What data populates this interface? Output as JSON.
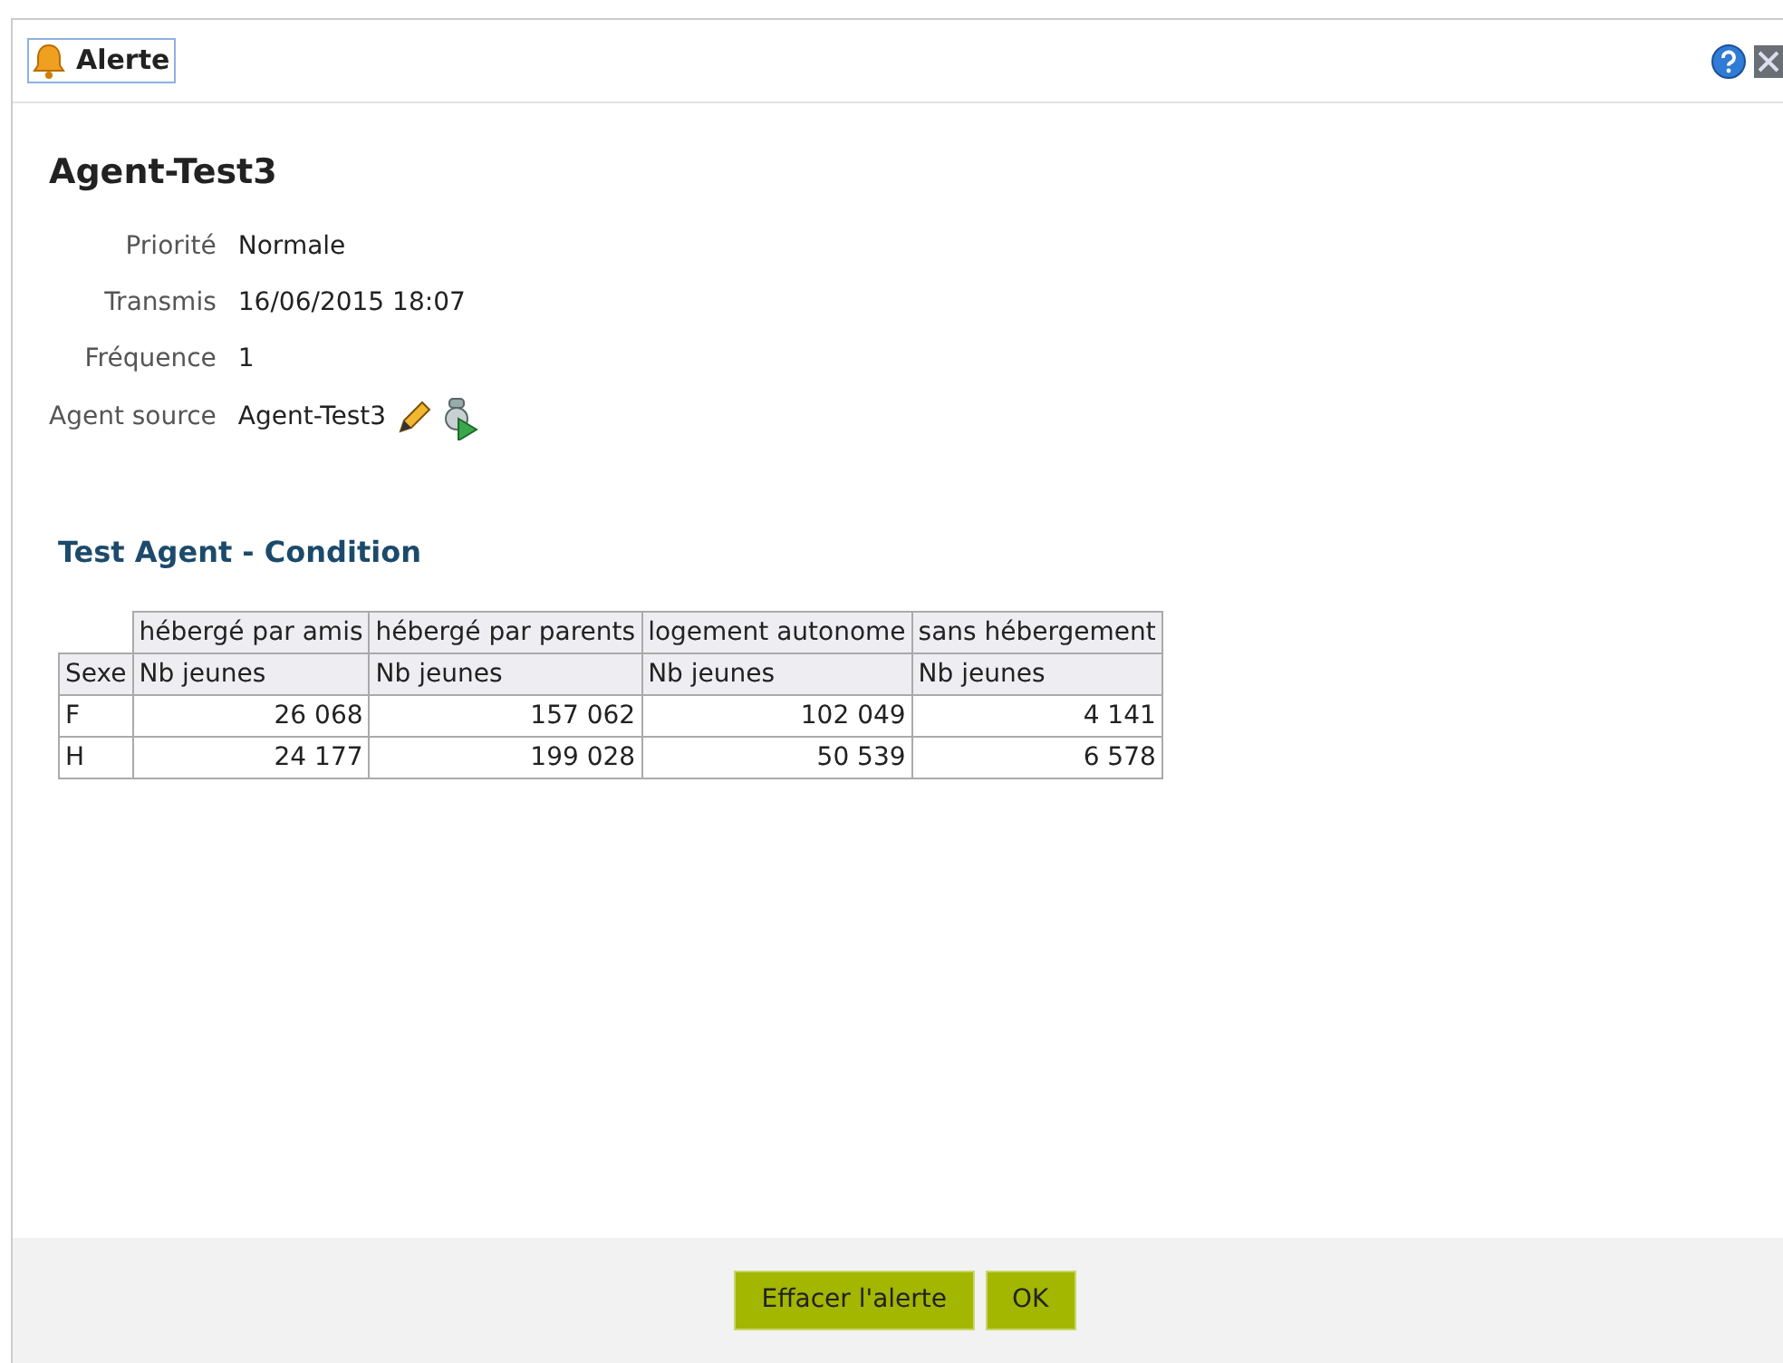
{
  "window": {
    "title": "Alerte"
  },
  "agent": {
    "name": "Agent-Test3"
  },
  "fields": [
    {
      "label": "Priorité",
      "value": "Normale"
    },
    {
      "label": "Transmis",
      "value": "16/06/2015 18:07"
    },
    {
      "label": "Fréquence",
      "value": "1"
    },
    {
      "label": "Agent source",
      "value": "Agent-Test3",
      "kind": "agent"
    }
  ],
  "section_title": "Test Agent - Condition",
  "table": {
    "columns": [
      "hébergé par amis",
      "hébergé par parents",
      "logement autonome",
      "sans hébergement"
    ],
    "row_header": "Sexe",
    "measures": [
      "Nb jeunes",
      "Nb jeunes",
      "Nb jeunes",
      "Nb jeunes"
    ],
    "rows": [
      {
        "label": "F",
        "values": [
          "26 068",
          "157 062",
          "102 049",
          "4 141"
        ]
      },
      {
        "label": "H",
        "values": [
          "24 177",
          "199 028",
          "50 539",
          "6 578"
        ]
      }
    ]
  },
  "buttons": [
    "Effacer l'alerte",
    "OK"
  ]
}
